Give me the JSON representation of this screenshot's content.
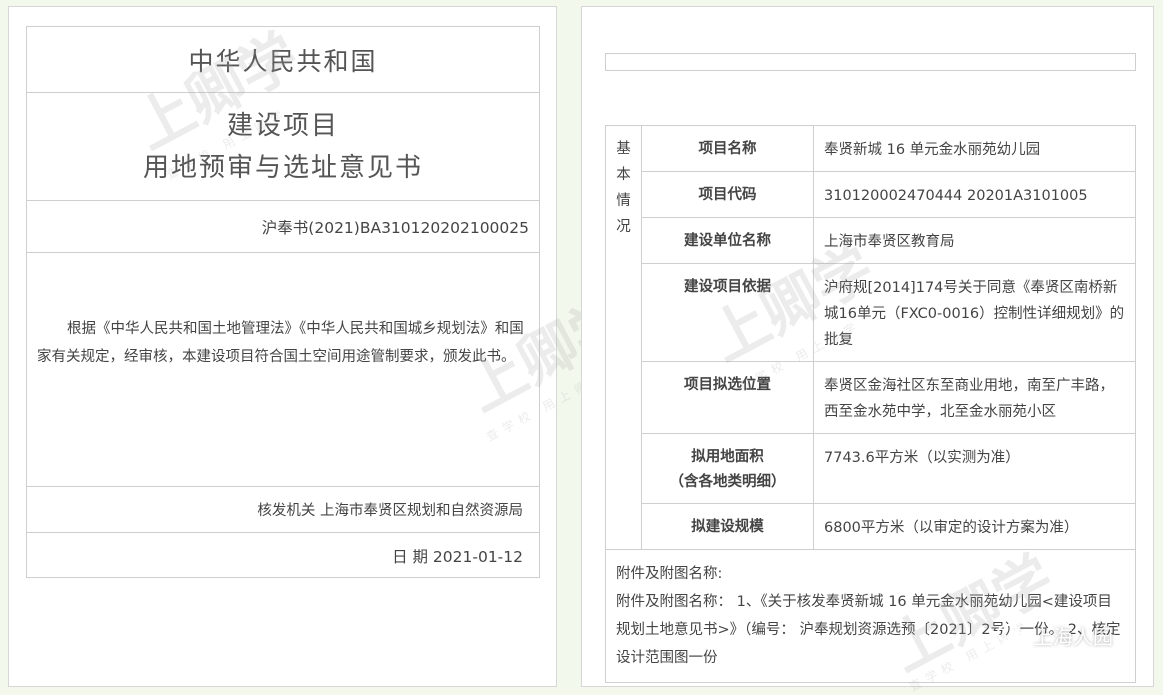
{
  "certificate": {
    "country": "中华人民共和国",
    "title_line1": "建设项目",
    "title_line2": "用地预审与选址意见书",
    "number": "沪奉书(2021)BA310120202100025",
    "body": "根据《中华人民共和国土地管理法》《中华人民共和国城乡规划法》和国家有关规定，经审核，本建设项目符合国土空间用途管制要求，颁发此书。",
    "issuer": "核发机关  上海市奉贤区规划和自然资源局",
    "date": "日  期  2021-01-12"
  },
  "info": {
    "section_label": "基本情况",
    "rows": [
      {
        "label": "项目名称",
        "value": "奉贤新城 16 单元金水丽苑幼儿园"
      },
      {
        "label": "项目代码",
        "value": "310120002470444 20201A3101005"
      },
      {
        "label": "建设单位名称",
        "value": "上海市奉贤区教育局"
      },
      {
        "label": "建设项目依据",
        "value": "沪府规[2014]174号关于同意《奉贤区南桥新城16单元（FXC0-0016）控制性详细规划》的批复"
      },
      {
        "label": "项目拟选位置",
        "value": "奉贤区金海社区东至商业用地，南至广丰路，西至金水苑中学，北至金水丽苑小区"
      },
      {
        "label": "拟用地面积",
        "label2": "（含各地类明细）",
        "value": "7743.6平方米（以实测为准）"
      },
      {
        "label": "拟建设规模",
        "value": "6800平方米（以审定的设计方案为准）"
      }
    ],
    "attachments_heading": "附件及附图名称:",
    "attachments_text": "附件及附图名称：  1、《关于核发奉贤新城 16 单元金水丽苑幼儿园<建设项目规划土地意见书>》（编号：  沪奉规划资源选预〔2021〕2号）一份。 2、核定设计范围图一份"
  },
  "watermark": {
    "brand": "上卿学",
    "tagline": "查学校 用上卿学"
  },
  "badge": {
    "icon": "wechat-icon",
    "text": "上海人园"
  }
}
